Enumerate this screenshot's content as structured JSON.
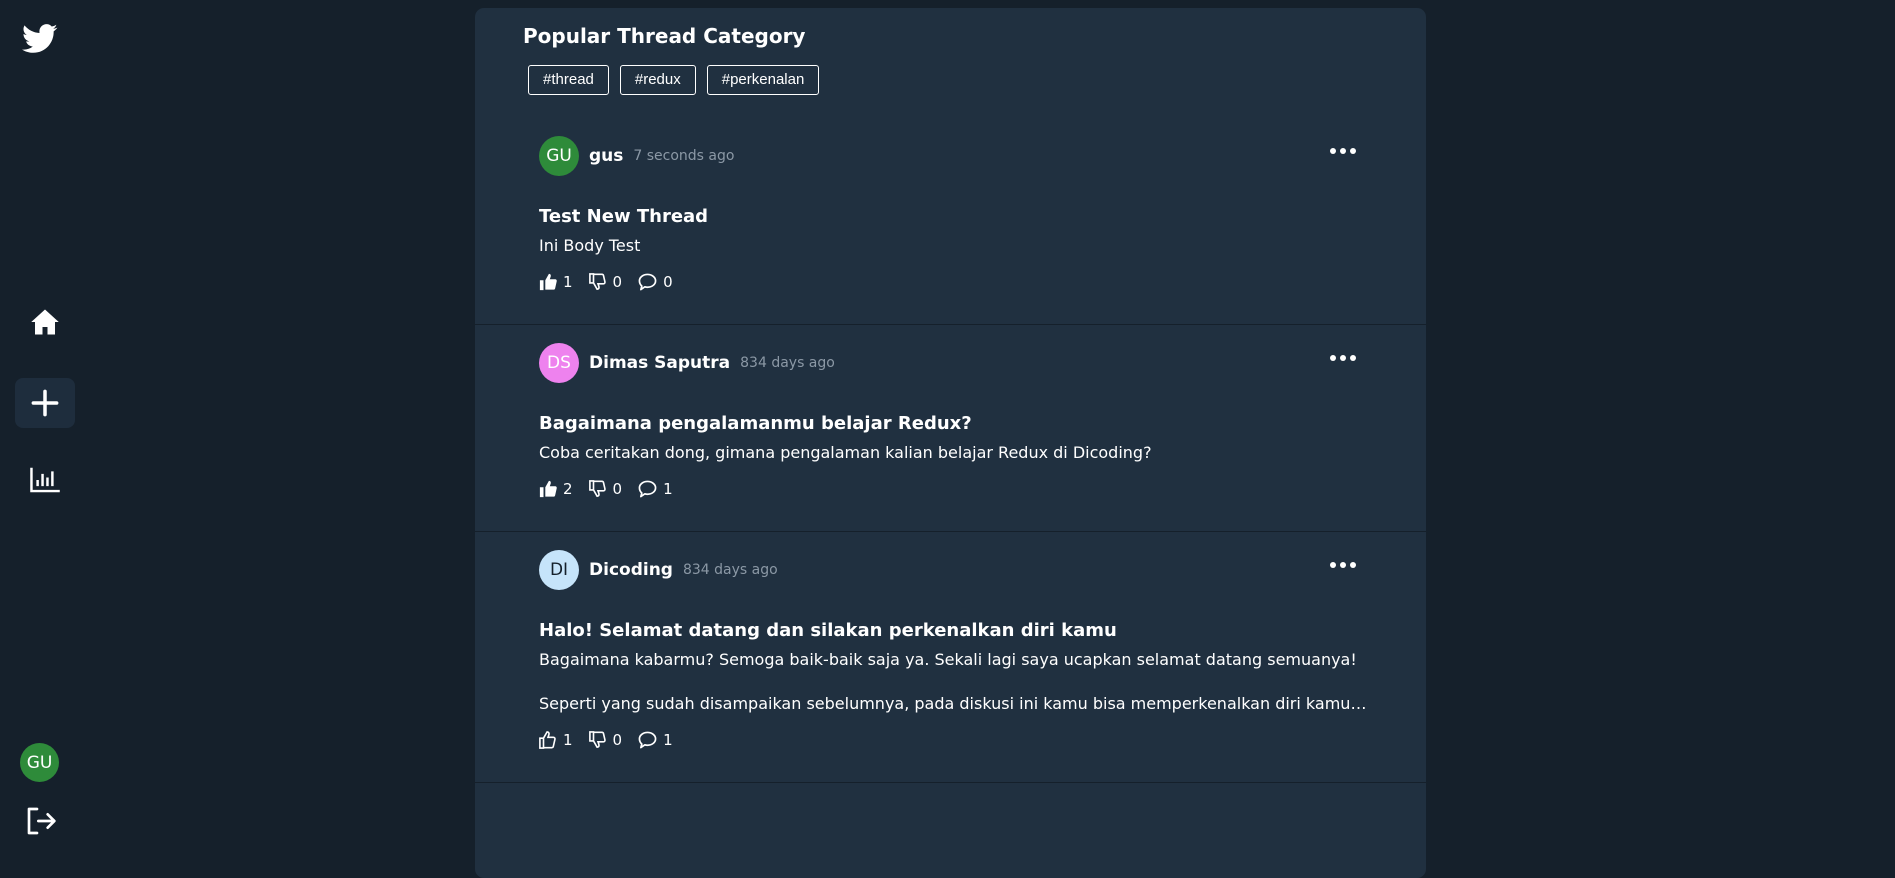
{
  "sidebar": {
    "logo_icon": "twitter-bird-icon",
    "nav": [
      {
        "name": "home",
        "icon": "home-icon"
      },
      {
        "name": "new-thread",
        "icon": "plus-icon",
        "active": true
      },
      {
        "name": "leaderboards",
        "icon": "bar-chart-icon"
      }
    ],
    "user_initials": "GU",
    "user_avatar_color": "#2e8b3a",
    "logout_icon": "logout-icon"
  },
  "popular": {
    "title": "Popular Thread Category",
    "categories": [
      "#thread",
      "#redux",
      "#perkenalan"
    ]
  },
  "threads": [
    {
      "initials": "GU",
      "avatar_color": "#2e8b3a",
      "owner": "gus",
      "created": "7 seconds ago",
      "title": "Test New Thread",
      "body": [
        "Ini Body Test"
      ],
      "upvotes": "1",
      "downvotes": "0",
      "comments": "0",
      "upvoted": true
    },
    {
      "initials": "DS",
      "avatar_color": "#ee82ee",
      "owner": "Dimas Saputra",
      "created": "834 days ago",
      "title": "Bagaimana pengalamanmu belajar Redux?",
      "body": [
        "Coba ceritakan dong, gimana pengalaman kalian belajar Redux di Dicoding?"
      ],
      "upvotes": "2",
      "downvotes": "0",
      "comments": "1",
      "upvoted": true
    },
    {
      "initials": "DI",
      "avatar_color": "#c6e4fa",
      "owner": "Dicoding",
      "created": "834 days ago",
      "title": "Halo! Selamat datang dan silakan perkenalkan diri kamu",
      "body": [
        "Bagaimana kabarmu? Semoga baik-baik saja ya. Sekali lagi saya ucapkan selamat datang semuanya!",
        "Seperti yang sudah disampaikan sebelumnya, pada diskusi ini kamu bisa memperkenalkan diri kamu dan ju..."
      ],
      "upvotes": "1",
      "downvotes": "0",
      "comments": "1",
      "upvoted": false
    }
  ]
}
